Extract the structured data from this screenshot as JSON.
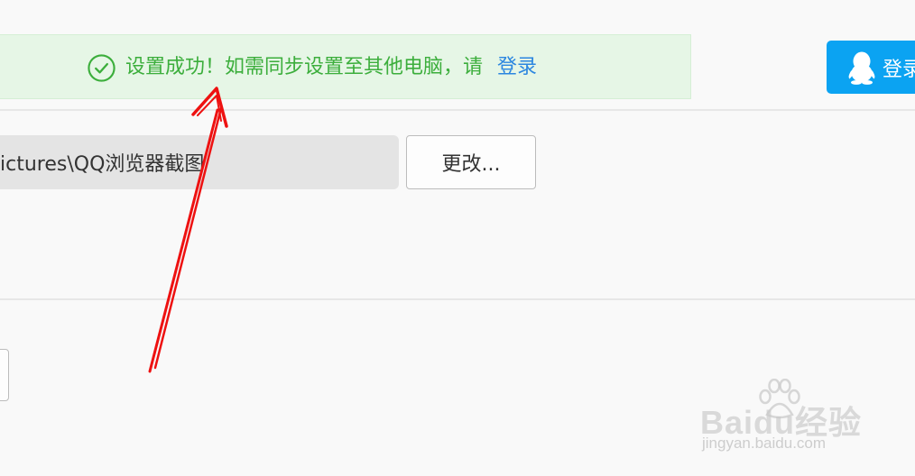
{
  "banner": {
    "message": "设置成功！如需同步设置至其他电脑，请",
    "link_label": "登录",
    "icon": "check-circle-icon"
  },
  "header": {
    "login_button_label": "登录",
    "login_icon": "qq-penguin-icon"
  },
  "download": {
    "path_value": "ictures\\QQ浏览器截图",
    "change_button_label": "更改..."
  },
  "watermark": {
    "brand": "Baidu经验",
    "url": "jingyan.baidu.com"
  },
  "colors": {
    "banner_bg": "#e6f6e6",
    "banner_text": "#3cae3c",
    "link": "#2b86e0",
    "login_button_bg": "#0ba3f2",
    "annotation_arrow": "#ee1111"
  }
}
